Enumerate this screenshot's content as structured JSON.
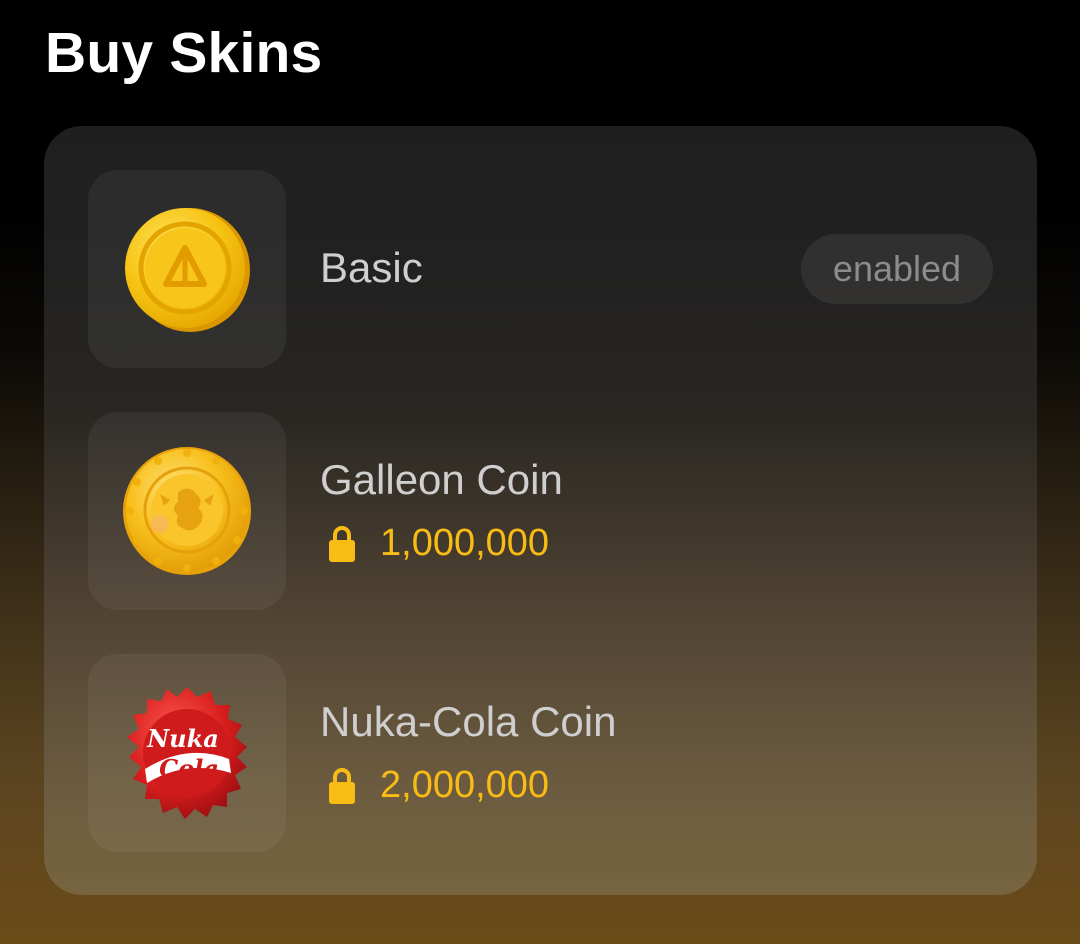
{
  "header": {
    "title": "Buy Skins"
  },
  "skins": [
    {
      "name": "Basic",
      "status": "enabled",
      "icon": "basic-coin-icon"
    },
    {
      "name": "Galleon Coin",
      "price": "1,000,000",
      "locked": true,
      "icon": "galleon-coin-icon"
    },
    {
      "name": "Nuka-Cola Coin",
      "price": "2,000,000",
      "locked": true,
      "icon": "nuka-cola-coin-icon",
      "icon_text": [
        "Nuka",
        "Cola"
      ]
    }
  ],
  "colors": {
    "price": "#f8bc14",
    "text": "#cfcfcf",
    "coin_gold": "#f5c518",
    "nuka_red": "#d81e1e"
  }
}
